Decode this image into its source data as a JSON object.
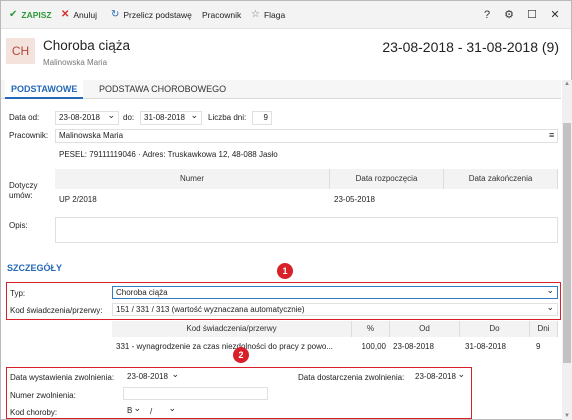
{
  "toolbar": {
    "save": "ZAPISZ",
    "cancel": "Anuluj",
    "recalc": "Przelicz podstawę",
    "employee": "Pracownik",
    "flag": "Flaga",
    "help": "?",
    "settings": "⚙",
    "maximize": "☐",
    "close": "✕",
    "colors": {
      "save": "#2f9a3a",
      "cancel": "#d62d2d",
      "recalc": "#2468b8"
    }
  },
  "header": {
    "avatar": "CH",
    "title": "Choroba ciąża",
    "subtitle": "Malinowska Maria",
    "range": "23-08-2018 - 31-08-2018 (9)"
  },
  "tabs": [
    "PODSTAWOWE",
    "PODSTAWA CHOROBOWEGO"
  ],
  "basic": {
    "date_from_label": "Data od:",
    "date_from": "23-08-2018",
    "date_to_label": "do:",
    "date_to": "31-08-2018",
    "days_label": "Liczba dni:",
    "days": "9",
    "employee_label": "Pracownik:",
    "employee": "Malinowska Maria",
    "employee_details": "PESEL: 79111119046  ·  Adres: Truskawkowa 12, 48-088 Jasło",
    "contracts_label_1": "Dotyczy",
    "contracts_label_2": "umów:",
    "contracts_headers": [
      "Numer",
      "Data rozpoczęcia",
      "Data zakończenia"
    ],
    "contracts_rows": [
      [
        "UP 2/2018",
        "23-05-2018",
        ""
      ]
    ],
    "desc_label": "Opis:"
  },
  "details": {
    "section_title": "SZCZEGÓŁY",
    "type_label": "Typ:",
    "type_value": "Choroba ciąża",
    "code_label": "Kod świadczenia/przerwy:",
    "code_value": "151 / 331 / 313   (wartość wyznaczana automatycznie)",
    "badge1": "1",
    "badge2": "2",
    "benefit_headers": [
      "Kod świadczenia/przerwy",
      "%",
      "Od",
      "Do",
      "Dni"
    ],
    "benefit_rows": [
      [
        "331 - wynagrodzenie za czas niezdolności do pracy z powo...",
        "100,00",
        "23-08-2018",
        "31-08-2018",
        "9"
      ]
    ],
    "issue_label": "Data wystawienia zwolnienia:",
    "issue_date": "23-08-2018",
    "delivery_label": "Data dostarczenia zwolnienia:",
    "delivery_date": "23-08-2018",
    "number_label": "Numer zwolnienia:",
    "number_value": "",
    "disease_label": "Kod choroby:",
    "disease_code": "B",
    "disease_sep": "/",
    "disease_code2": ""
  }
}
